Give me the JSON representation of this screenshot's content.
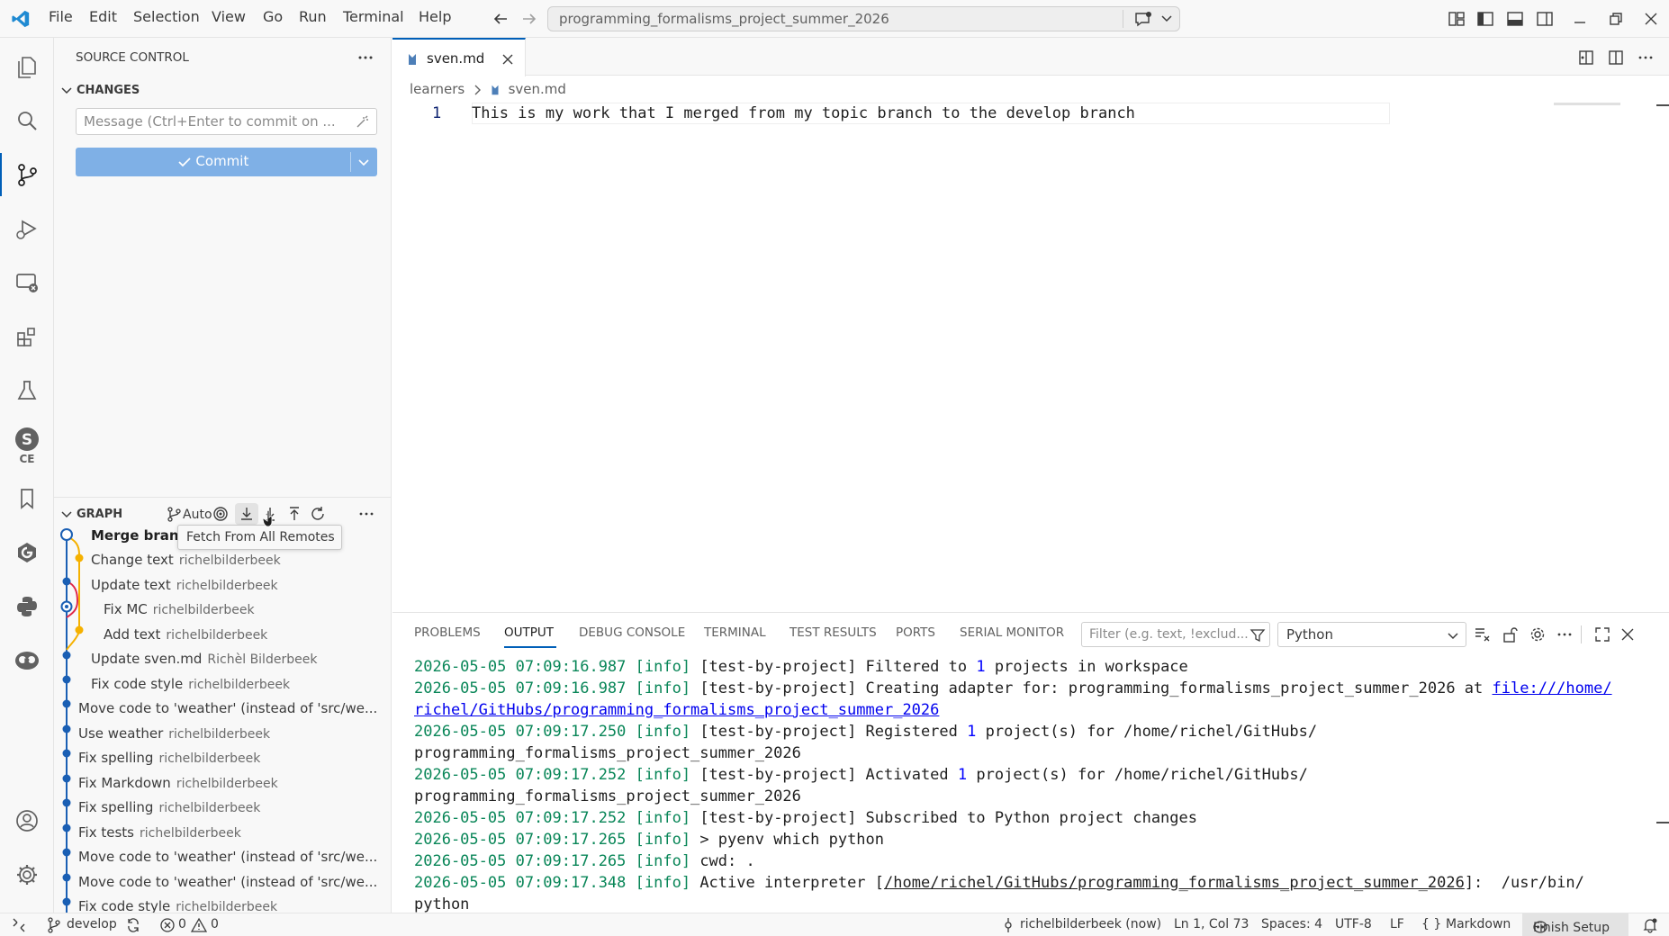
{
  "titlebar": {
    "menus": [
      "File",
      "Edit",
      "Selection",
      "View",
      "Go",
      "Run",
      "Terminal",
      "Help"
    ],
    "search_text": "programming_formalisms_project_summer_2026"
  },
  "activitybar": {
    "items": [
      "explorer-icon",
      "search-icon",
      "source-control-icon",
      "run-debug-icon",
      "remote-explorer-icon",
      "extensions-icon",
      "testing-icon",
      "sce-icon",
      "bookmarks-icon",
      "gitlens-icon",
      "python-icon",
      "copilot-icon",
      "accounts-icon",
      "settings-icon"
    ],
    "sce_label": "CE"
  },
  "sidebar": {
    "title": "SOURCE CONTROL",
    "changes_label": "CHANGES",
    "message_placeholder": "Message (Ctrl+Enter to commit on ...",
    "commit_label": "Commit",
    "graph_label": "GRAPH",
    "auto_label": "Auto",
    "tooltip": "Fetch From All Remotes",
    "graph_rows": [
      {
        "msg": "Merge branc",
        "author": ""
      },
      {
        "msg": "Change text",
        "author": "richelbilderbeek"
      },
      {
        "msg": "Update text",
        "author": "richelbilderbeek"
      },
      {
        "msg": "Fix MC",
        "author": "richelbilderbeek"
      },
      {
        "msg": "Add text",
        "author": "richelbilderbeek"
      },
      {
        "msg": "Update sven.md",
        "author": "Richèl Bilderbeek"
      },
      {
        "msg": "Fix code style",
        "author": "richelbilderbeek"
      },
      {
        "msg": "Move code to 'weather' (instead of 'src/we...",
        "author": ""
      },
      {
        "msg": "Use weather",
        "author": "richelbilderbeek"
      },
      {
        "msg": "Fix spelling",
        "author": "richelbilderbeek"
      },
      {
        "msg": "Fix Markdown",
        "author": "richelbilderbeek"
      },
      {
        "msg": "Fix spelling",
        "author": "richelbilderbeek"
      },
      {
        "msg": "Fix tests",
        "author": "richelbilderbeek"
      },
      {
        "msg": "Move code to 'weather' (instead of 'src/we...",
        "author": ""
      },
      {
        "msg": "Move code to 'weather' (instead of 'src/we...",
        "author": ""
      },
      {
        "msg": "Fix code style",
        "author": "richelbilderbeek"
      }
    ]
  },
  "editor": {
    "tab_label": "sven.md",
    "breadcrumb_folder": "learners",
    "breadcrumb_file": "sven.md",
    "line_number": "1",
    "line_text": "This is my work that I merged from my topic branch to the develop branch"
  },
  "panel": {
    "tabs": [
      "PROBLEMS",
      "OUTPUT",
      "DEBUG CONSOLE",
      "TERMINAL",
      "TEST RESULTS",
      "PORTS",
      "SERIAL MONITOR"
    ],
    "active_tab": "OUTPUT",
    "filter_placeholder": "Filter (e.g. text, !exclud...",
    "channel": "Python",
    "log": {
      "l1_ts": "2026-05-05 07:09:16.987",
      "l1_a": " [test-by-project] Filtered to ",
      "l1_n": "1",
      "l1_b": " projects in workspace",
      "l2_ts": "2026-05-05 07:09:16.987",
      "l2_a": " [test-by-project] Creating adapter for: programming_formalisms_project_summer_2026 at ",
      "l2_link1": "file:///home/",
      "l2_link2": "richel/GitHubs/programming_formalisms_project_summer_2026",
      "l3_ts": "2026-05-05 07:09:17.250",
      "l3_a": " [test-by-project] Registered ",
      "l3_n": "1",
      "l3_b": " project(s) for /home/richel/GitHubs/",
      "l3_c": "programming_formalisms_project_summer_2026",
      "l4_ts": "2026-05-05 07:09:17.252",
      "l4_a": " [test-by-project] Activated ",
      "l4_n": "1",
      "l4_b": " project(s) for /home/richel/GitHubs/",
      "l4_c": "programming_formalisms_project_summer_2026",
      "l5_ts": "2026-05-05 07:09:17.252",
      "l5_a": " [test-by-project] Subscribed to Python project changes",
      "l6_ts": "2026-05-05 07:09:17.265",
      "l6_a": " > pyenv which python",
      "l7_ts": "2026-05-05 07:09:17.265",
      "l7_a": " cwd: .",
      "l8_ts": "2026-05-05 07:09:17.348",
      "l8_a": " Active interpreter [",
      "l8_path": "/home/richel/GitHubs/programming_formalisms_project_summer_2026",
      "l8_b": "]:  /usr/bin/",
      "l9": "python",
      "info": "[info]"
    }
  },
  "statusbar": {
    "branch": "develop",
    "errors": "0",
    "warnings": "0",
    "blame": "richelbilderbeek (now)",
    "position": "Ln 1, Col 73",
    "spaces": "Spaces: 4",
    "encoding": "UTF-8",
    "eol": "LF",
    "language": "Markdown",
    "finish_setup": "Finish Setup"
  }
}
